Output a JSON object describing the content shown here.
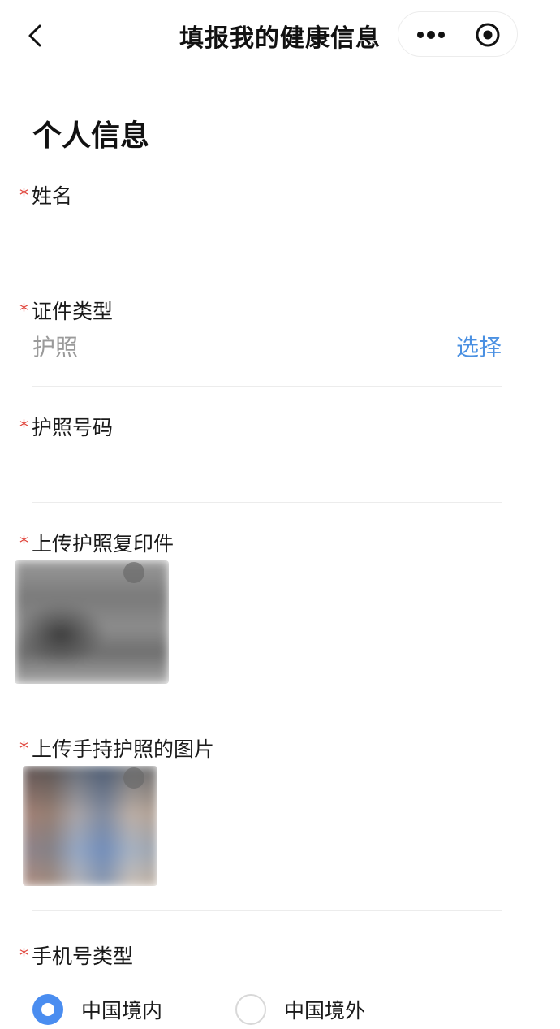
{
  "navbar": {
    "title": "填报我的健康信息",
    "back_icon": "chevron-left-icon",
    "more_icon": "more-dots-icon",
    "close_icon": "target-circle-icon"
  },
  "section_title": "个人信息",
  "required_mark": "*",
  "fields": {
    "name": {
      "label": "姓名",
      "value": ""
    },
    "id_type": {
      "label": "证件类型",
      "value": "护照",
      "action": "选择"
    },
    "passport_no": {
      "label": "护照号码",
      "value": ""
    },
    "passport_copy": {
      "label": "上传护照复印件"
    },
    "passport_handheld": {
      "label": "上传手持护照的图片"
    },
    "phone_type": {
      "label": "手机号类型",
      "options": [
        {
          "label": "中国境内",
          "selected": true
        },
        {
          "label": "中国境外",
          "selected": false
        }
      ]
    }
  },
  "colors": {
    "accent": "#4a8df0",
    "link": "#4a90e2",
    "required": "#e0433a",
    "placeholder": "#9a9a9a"
  }
}
